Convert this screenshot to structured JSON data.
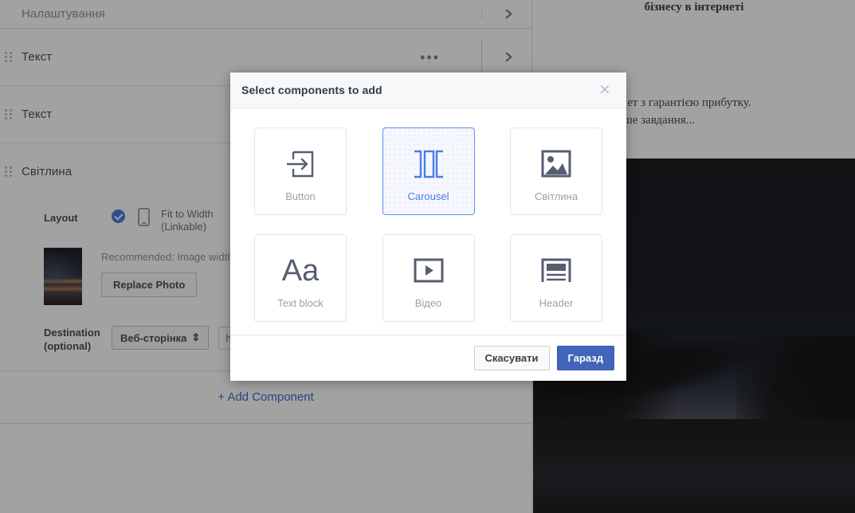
{
  "editor": {
    "settings_row": {
      "label": "Налаштування",
      "chevron_icon": "chevron-right-icon"
    },
    "components": [
      {
        "label": "Текст",
        "menu_icon": "more-options-icon",
        "menu_label": "•••",
        "chevron_icon": "chevron-right-icon"
      },
      {
        "label": "Текст",
        "chevron_icon": "chevron-right-icon"
      },
      {
        "label": "Світлина",
        "chevron_icon": "chevron-right-icon"
      }
    ],
    "photo_component": {
      "layout_label": "Layout",
      "layout_option_label": "Fit to Width\n(Linkable)",
      "layout_option_line1": "Fit to Width",
      "layout_option_line2": "(Linkable)",
      "layout_selected": true,
      "phone_icon": "phone-icon",
      "recommended_text": "Recommended: Image width o",
      "replace_photo_label": "Replace Photo",
      "destination_label_line1": "Destination",
      "destination_label_line2": "(optional)",
      "destination_select_value": "Веб-сторінка",
      "destination_url_placeholder": "http://",
      "destination_url_value": ""
    },
    "add_component_label": "+ Add Component"
  },
  "preview": {
    "heading": "бізнесу в інтернеті",
    "paragraph_line1": "о бізнес в інтернет з гарантією прибутку.",
    "paragraph_line2": "аші клієнти - наше завдання..."
  },
  "modal": {
    "title": "Select components to add",
    "close_icon": "close-icon",
    "cards": [
      {
        "label": "Button",
        "icon": "button-arrow-icon",
        "selected": false
      },
      {
        "label": "Carousel",
        "icon": "carousel-icon",
        "selected": true
      },
      {
        "label": "Світлина",
        "icon": "image-icon",
        "selected": false
      },
      {
        "label": "Text block",
        "icon": "text-block-icon",
        "selected": false,
        "glyph": "Aa"
      },
      {
        "label": "Відео",
        "icon": "video-play-icon",
        "selected": false
      },
      {
        "label": "Header",
        "icon": "header-icon",
        "selected": false
      }
    ],
    "cancel_label": "Скасувати",
    "ok_label": "Гаразд"
  },
  "colors": {
    "accent_blue": "#4b7bec",
    "primary_button": "#4265ba",
    "link_blue": "#2f5fc4",
    "icon_dark": "#565e70"
  }
}
